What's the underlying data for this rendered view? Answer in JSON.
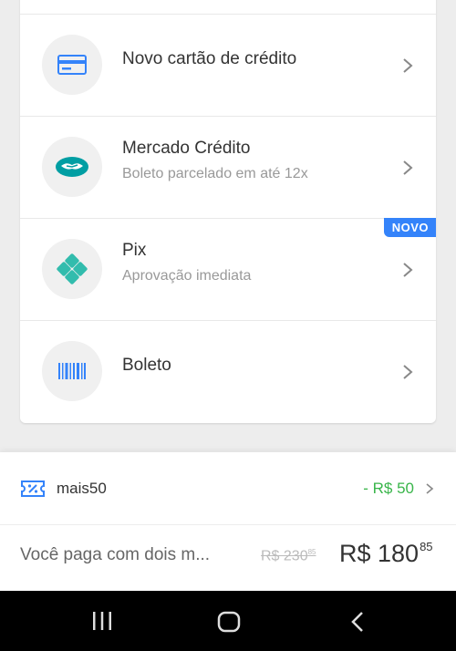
{
  "payment_options": [
    {
      "title": "Novo cartão de crédito",
      "subtitle": "",
      "icon": "credit-card-icon"
    },
    {
      "title": "Mercado Crédito",
      "subtitle": "Boleto parcelado em até 12x",
      "icon": "handshake-icon"
    },
    {
      "title": "Pix",
      "subtitle": "Aprovação imediata",
      "icon": "pix-icon",
      "badge": "NOVO"
    },
    {
      "title": "Boleto",
      "subtitle": "",
      "icon": "barcode-icon"
    }
  ],
  "coupon": {
    "code": "mais50",
    "discount": "- R$ 50",
    "icon": "coupon-ticket-icon"
  },
  "payment_summary": {
    "text": "Você paga com dois m...",
    "old_price_main": "R$ 230",
    "old_price_cents": "85",
    "new_price_main": "R$ 180",
    "new_price_cents": "85"
  },
  "colors": {
    "accent_blue": "#3483fa",
    "discount_green": "#39b54a",
    "pix_teal": "#32bcad",
    "mercado_credito_teal": "#009ea3"
  },
  "system_nav": {
    "recent_icon": "recent-apps-icon",
    "home_icon": "home-icon",
    "back_icon": "back-icon"
  }
}
